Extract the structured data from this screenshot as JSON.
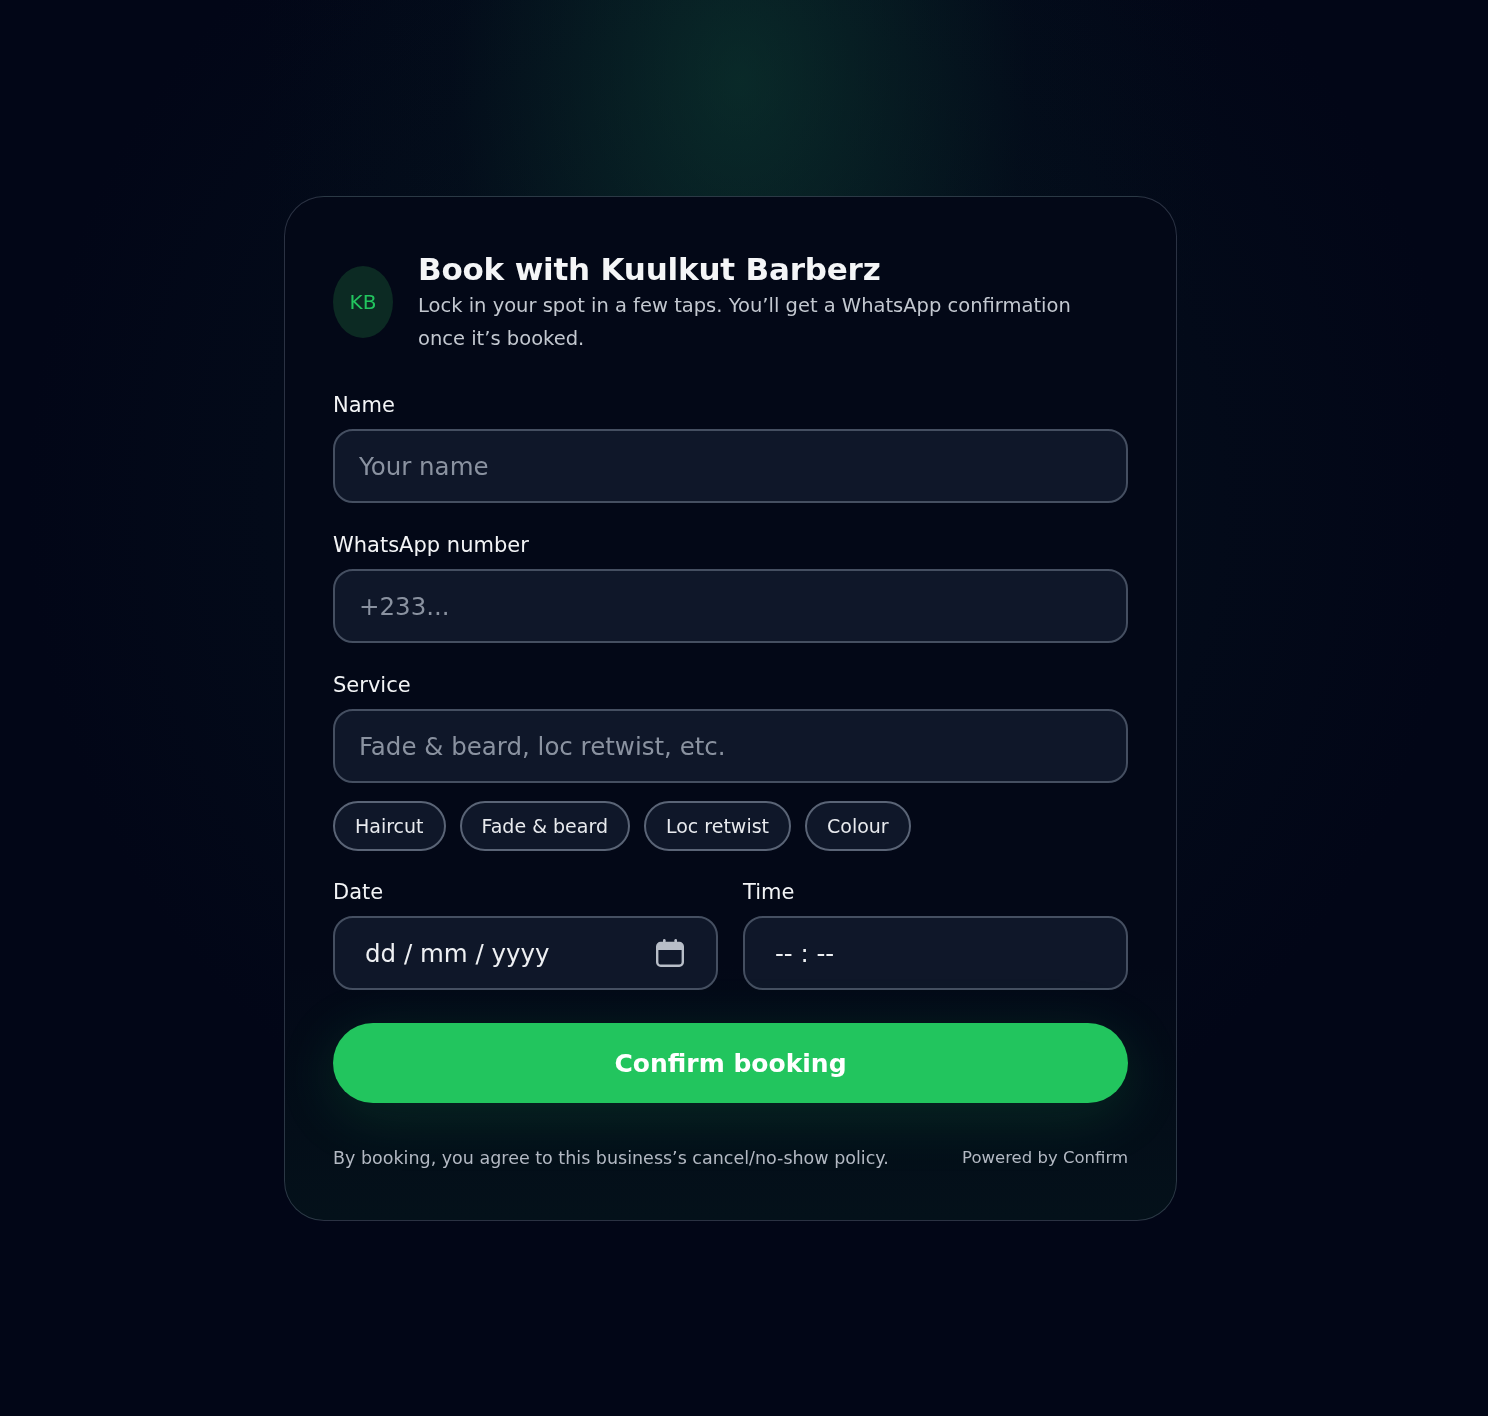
{
  "brand": {
    "initials": "KB",
    "title": "Book with Kuulkut Barberz",
    "subtitle": "Lock in your spot in a few taps. You’ll get a WhatsApp confirmation once it’s booked."
  },
  "fields": [
    {
      "label": "Name",
      "placeholder": "Your name"
    },
    {
      "label": "WhatsApp number",
      "placeholder": "+233..."
    },
    {
      "label": "Service",
      "placeholder": "Fade & beard, loc retwist, etc."
    }
  ],
  "service_chips": [
    "Haircut",
    "Fade & beard",
    "Loc retwist",
    "Colour"
  ],
  "schedule": [
    {
      "label": "Date",
      "placeholder": "dd / mm / yyyy",
      "kind": "date"
    },
    {
      "label": "Time",
      "placeholder": "-- : --",
      "kind": "time"
    }
  ],
  "submit": "Confirm booking",
  "footer": {
    "policy": "By booking, you agree to this business’s cancel/no-show policy.",
    "powered_by": "Powered by Confirm"
  }
}
